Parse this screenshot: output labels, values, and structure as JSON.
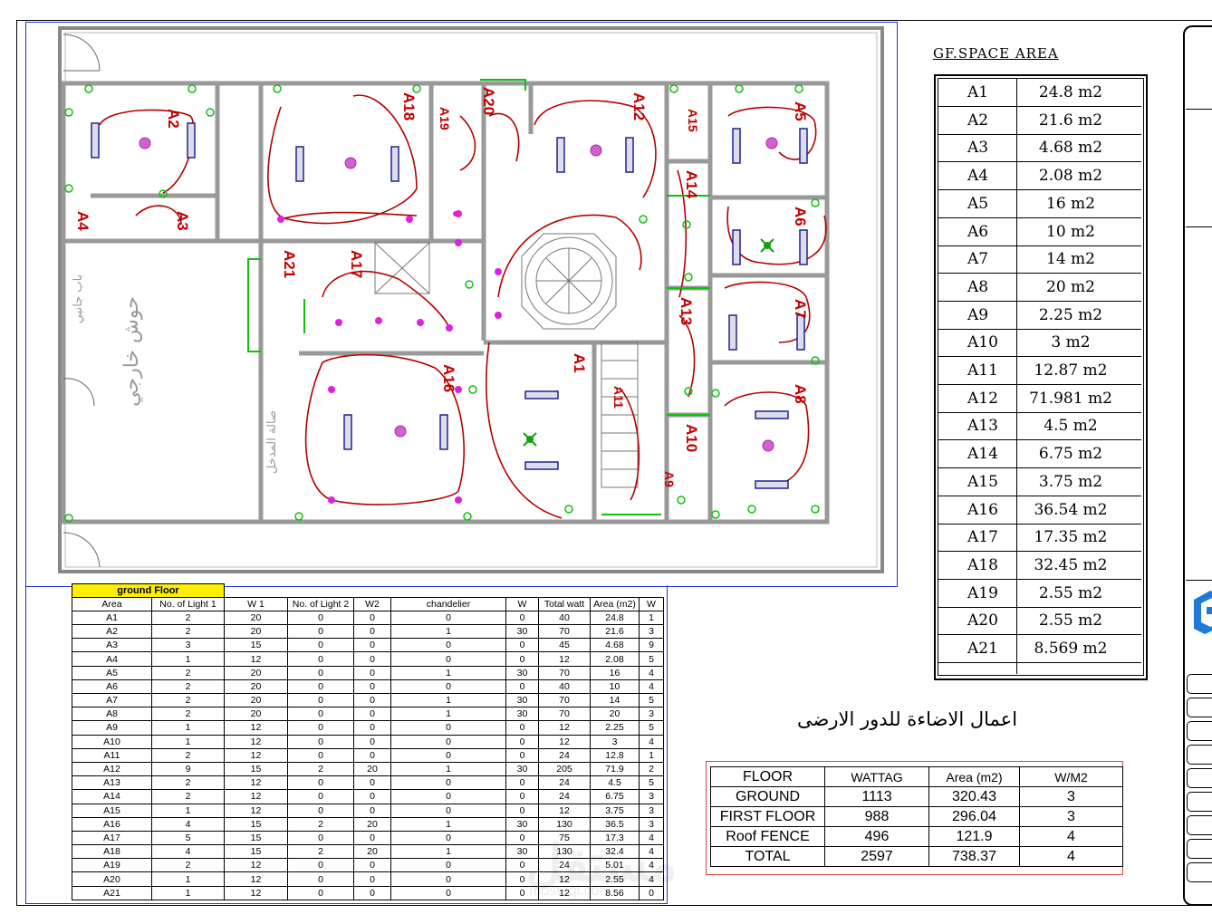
{
  "space_area": {
    "title": "GF.SPACE AREA",
    "rows": [
      {
        "area": "A1",
        "value": "24.8 m2"
      },
      {
        "area": "A2",
        "value": "21.6 m2"
      },
      {
        "area": "A3",
        "value": "4.68 m2"
      },
      {
        "area": "A4",
        "value": "2.08 m2"
      },
      {
        "area": "A5",
        "value": "16 m2"
      },
      {
        "area": "A6",
        "value": "10 m2"
      },
      {
        "area": "A7",
        "value": "14 m2"
      },
      {
        "area": "A8",
        "value": "20 m2"
      },
      {
        "area": "A9",
        "value": "2.25 m2"
      },
      {
        "area": "A10",
        "value": "3 m2"
      },
      {
        "area": "A11",
        "value": "12.87 m2"
      },
      {
        "area": "A12",
        "value": "71.981 m2"
      },
      {
        "area": "A13",
        "value": "4.5 m2"
      },
      {
        "area": "A14",
        "value": "6.75 m2"
      },
      {
        "area": "A15",
        "value": "3.75 m2"
      },
      {
        "area": "A16",
        "value": "36.54 m2"
      },
      {
        "area": "A17",
        "value": "17.35 m2"
      },
      {
        "area": "A18",
        "value": "32.45 m2"
      },
      {
        "area": "A19",
        "value": "2.55 m2"
      },
      {
        "area": "A20",
        "value": "2.55 m2"
      },
      {
        "area": "A21",
        "value": "8.569 m2"
      }
    ]
  },
  "lighting_table": {
    "floor_label": "ground Floor",
    "headers": [
      "Area",
      "No. of Light 1",
      "W 1",
      "No. of Light 2",
      "W2",
      "chandelier",
      "W",
      "Total watt",
      "Area (m2)",
      "W"
    ],
    "rows": [
      [
        "A1",
        "2",
        "20",
        "0",
        "0",
        "0",
        "0",
        "40",
        "24.8",
        "1"
      ],
      [
        "A2",
        "2",
        "20",
        "0",
        "0",
        "1",
        "30",
        "70",
        "21.6",
        "3"
      ],
      [
        "A3",
        "3",
        "15",
        "0",
        "0",
        "0",
        "0",
        "45",
        "4.68",
        "9"
      ],
      [
        "A4",
        "1",
        "12",
        "0",
        "0",
        "0",
        "0",
        "12",
        "2.08",
        "5"
      ],
      [
        "A5",
        "2",
        "20",
        "0",
        "0",
        "1",
        "30",
        "70",
        "16",
        "4"
      ],
      [
        "A6",
        "2",
        "20",
        "0",
        "0",
        "0",
        "0",
        "40",
        "10",
        "4"
      ],
      [
        "A7",
        "2",
        "20",
        "0",
        "0",
        "1",
        "30",
        "70",
        "14",
        "5"
      ],
      [
        "A8",
        "2",
        "20",
        "0",
        "0",
        "1",
        "30",
        "70",
        "20",
        "3"
      ],
      [
        "A9",
        "1",
        "12",
        "0",
        "0",
        "0",
        "0",
        "12",
        "2.25",
        "5"
      ],
      [
        "A10",
        "1",
        "12",
        "0",
        "0",
        "0",
        "0",
        "12",
        "3",
        "4"
      ],
      [
        "A11",
        "2",
        "12",
        "0",
        "0",
        "0",
        "0",
        "24",
        "12.8",
        "1"
      ],
      [
        "A12",
        "9",
        "15",
        "2",
        "20",
        "1",
        "30",
        "205",
        "71.9",
        "2"
      ],
      [
        "A13",
        "2",
        "12",
        "0",
        "0",
        "0",
        "0",
        "24",
        "4.5",
        "5"
      ],
      [
        "A14",
        "2",
        "12",
        "0",
        "0",
        "0",
        "0",
        "24",
        "6.75",
        "3"
      ],
      [
        "A15",
        "1",
        "12",
        "0",
        "0",
        "0",
        "0",
        "12",
        "3.75",
        "3"
      ],
      [
        "A16",
        "4",
        "15",
        "2",
        "20",
        "1",
        "30",
        "130",
        "36.5",
        "3"
      ],
      [
        "A17",
        "5",
        "15",
        "0",
        "0",
        "0",
        "0",
        "75",
        "17.3",
        "4"
      ],
      [
        "A18",
        "4",
        "15",
        "2",
        "20",
        "1",
        "30",
        "130",
        "32.4",
        "4"
      ],
      [
        "A19",
        "2",
        "12",
        "0",
        "0",
        "0",
        "0",
        "24",
        "5.01",
        "4"
      ],
      [
        "A20",
        "1",
        "12",
        "0",
        "0",
        "0",
        "0",
        "12",
        "2.55",
        "4"
      ],
      [
        "A21",
        "1",
        "12",
        "0",
        "0",
        "0",
        "0",
        "12",
        "8.56",
        "0"
      ]
    ]
  },
  "summary_table": {
    "headers": [
      "FLOOR",
      "WATTAG",
      "Area (m2)",
      "W/M2"
    ],
    "rows": [
      [
        "GROUND",
        "1113",
        "320.43",
        "3"
      ],
      [
        "FIRST FLOOR",
        "988",
        "296.04",
        "3"
      ],
      [
        "Roof FENCE",
        "496",
        "121.9",
        "4"
      ],
      [
        "TOTAL",
        "2597",
        "738.37",
        "4"
      ]
    ]
  },
  "arabic_title": "اعمال الاضاءة للدور الارضى",
  "plan": {
    "room_labels": [
      "A2",
      "A3",
      "A4",
      "A18",
      "A19",
      "A20",
      "A12",
      "A15",
      "A5",
      "A14",
      "A6",
      "A21",
      "A17",
      "A13",
      "A7",
      "A16",
      "A1",
      "A11",
      "A8",
      "A10",
      "A9"
    ],
    "arabic_labels": {
      "courtyard": "حوش خارجي",
      "gate": "باب جانبي",
      "outer_room": "صالة المدخل"
    }
  },
  "watermark": {
    "text": "مستقل",
    "url": "mostaql.com"
  }
}
